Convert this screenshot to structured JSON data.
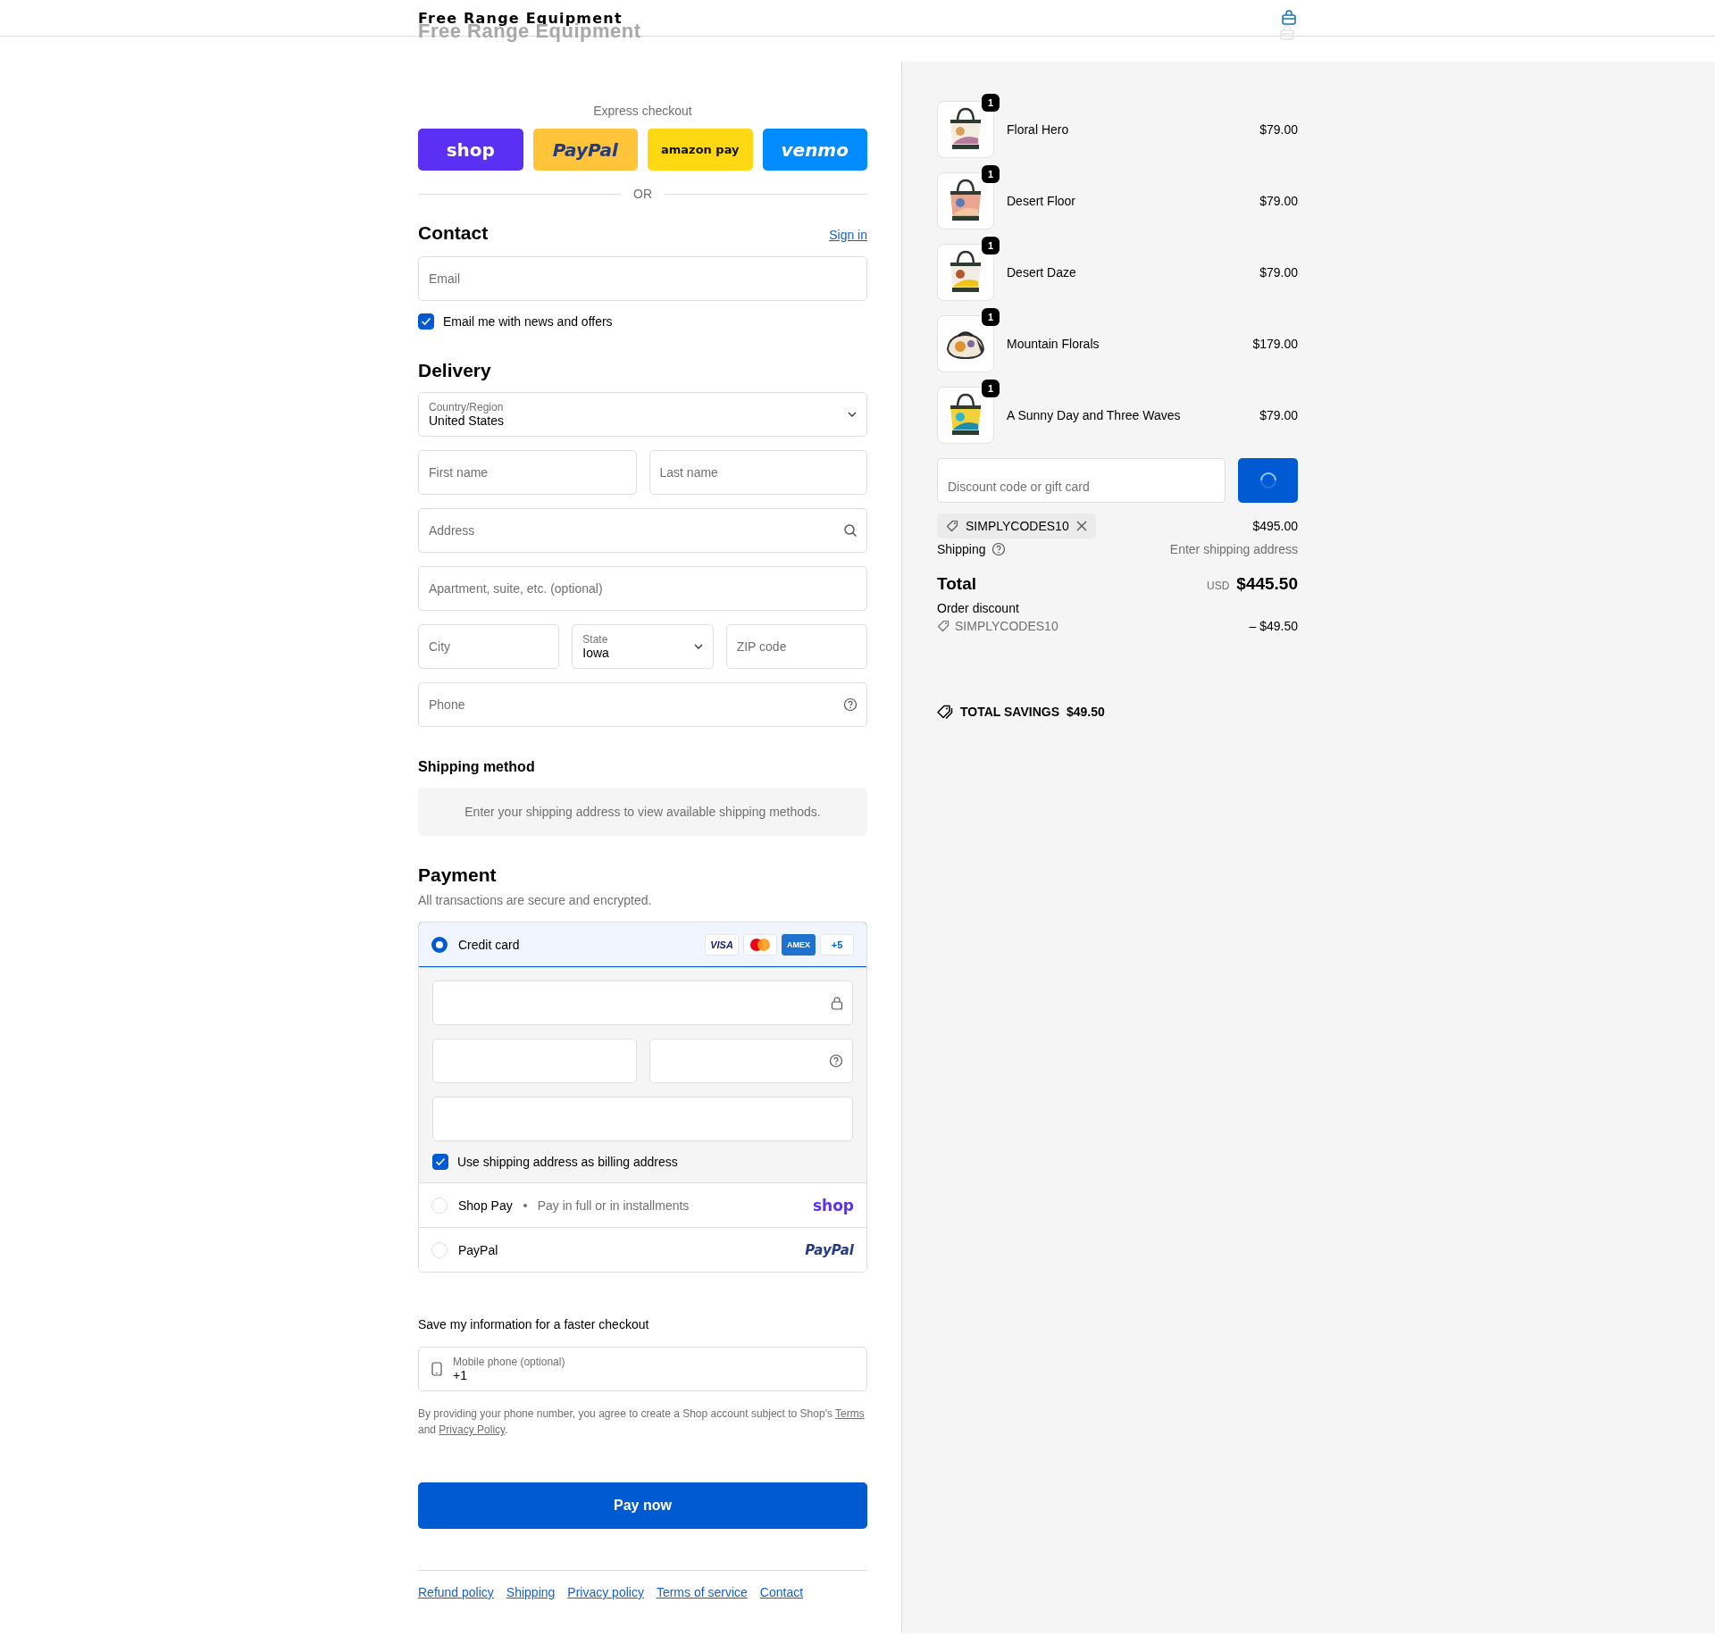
{
  "header": {
    "title": "Free Range Equipment",
    "ghost_title": "Free Range Equipment"
  },
  "express": {
    "label": "Express checkout",
    "buttons": [
      {
        "kind": "shop",
        "label": "shop"
      },
      {
        "kind": "paypal",
        "label": "PayPal"
      },
      {
        "kind": "amazon",
        "label": "amazon pay"
      },
      {
        "kind": "venmo",
        "label": "venmo"
      }
    ],
    "divider": "OR"
  },
  "contact": {
    "heading": "Contact",
    "sign_in": "Sign in",
    "email": {
      "placeholder": "Email"
    },
    "newsletter": {
      "label": "Email me with news and offers",
      "checked": true
    }
  },
  "delivery": {
    "heading": "Delivery",
    "rows": [
      [
        {
          "kind": "select",
          "label": "Country/Region",
          "value": "United States"
        }
      ],
      [
        {
          "kind": "text",
          "placeholder": "First name"
        },
        {
          "kind": "text",
          "placeholder": "Last name"
        }
      ],
      [
        {
          "kind": "search",
          "placeholder": "Address"
        }
      ],
      [
        {
          "kind": "text",
          "placeholder": "Apartment, suite, etc. (optional)"
        }
      ],
      [
        {
          "kind": "text",
          "placeholder": "City"
        },
        {
          "kind": "select",
          "label": "State",
          "value": "Iowa"
        },
        {
          "kind": "text",
          "placeholder": "ZIP code"
        }
      ],
      [
        {
          "kind": "help",
          "placeholder": "Phone"
        }
      ]
    ]
  },
  "shipping_method": {
    "heading": "Shipping method",
    "notice": "Enter your shipping address to view available shipping methods."
  },
  "payment": {
    "heading": "Payment",
    "subtitle": "All transactions are secure and encrypted.",
    "options": [
      {
        "kind": "card",
        "label": "Credit card",
        "selected": true,
        "badges": [
          {
            "kind": "visa",
            "label": "VISA"
          },
          {
            "kind": "mastercard"
          },
          {
            "kind": "amex",
            "label": "AMEX"
          },
          {
            "kind": "more",
            "label": "+5"
          }
        ],
        "card_rows": [
          [
            {
              "kind": "lock"
            }
          ],
          [
            {
              "kind": "text"
            },
            {
              "kind": "help"
            }
          ],
          [
            {
              "kind": "text"
            }
          ]
        ],
        "billing": {
          "label": "Use shipping address as billing address",
          "checked": true
        }
      },
      {
        "kind": "shop",
        "label": "Shop Pay",
        "note": "Pay in full or in installments",
        "logo": "shop",
        "selected": false
      },
      {
        "kind": "paypal",
        "label": "PayPal",
        "logo": "PayPal",
        "selected": false
      }
    ]
  },
  "save_info": {
    "heading": "Save my information for a faster checkout",
    "phone": {
      "label": "Mobile phone (optional)",
      "value": "+1"
    },
    "legal": {
      "before": "By providing your phone number, you agree to create a Shop account subject to Shop's ",
      "terms": "Terms",
      "middle": " and ",
      "privacy": "Privacy Policy",
      "after": "."
    }
  },
  "pay_button": "Pay now",
  "footer_links": [
    "Refund policy",
    "Shipping",
    "Privacy policy",
    "Terms of service",
    "Contact"
  ],
  "summary": {
    "items": [
      {
        "name": "Floral Hero",
        "price": "$79.00",
        "quantity": "1"
      },
      {
        "name": "Desert Floor",
        "price": "$79.00",
        "quantity": "1"
      },
      {
        "name": "Desert Daze",
        "price": "$79.00",
        "quantity": "1"
      },
      {
        "name": "Mountain Florals",
        "price": "$179.00",
        "quantity": "1"
      },
      {
        "name": "A Sunny Day and Three Waves",
        "price": "$79.00",
        "quantity": "1"
      }
    ],
    "discount": {
      "placeholder": "Discount code or gift card"
    },
    "applied_code": "SIMPLYCODES10",
    "subtotal": "$495.00",
    "shipping": {
      "label": "Shipping",
      "value": "Enter shipping address"
    },
    "total": {
      "label": "Total",
      "currency": "USD",
      "amount": "$445.50"
    },
    "order_discount": {
      "label": "Order discount",
      "code": "SIMPLYCODES10",
      "amount": "– $49.50"
    },
    "savings": {
      "label": "TOTAL SAVINGS",
      "amount": "$49.50"
    }
  }
}
